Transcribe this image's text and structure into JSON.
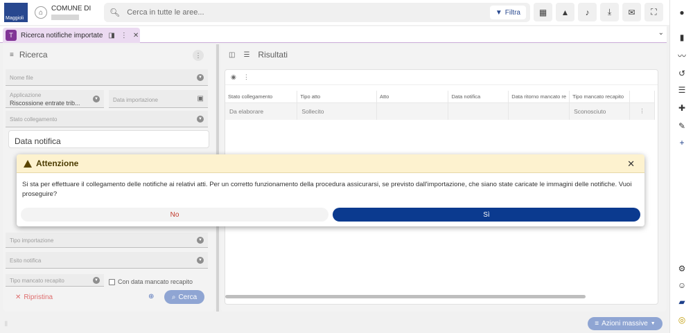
{
  "header": {
    "logo_text": "Maggioli",
    "comune_label": "COMUNE DI",
    "search_placeholder": "Cerca in tutte le aree...",
    "filter_label": "Filtra"
  },
  "tab": {
    "label": "Ricerca notifiche importate",
    "icon_text": "T"
  },
  "left_panel": {
    "title": "Ricerca",
    "fields": {
      "nome_file": "Nome file",
      "applicazione_label": "Applicazione",
      "applicazione_value": "Riscossione entrate trib...",
      "data_importazione": "Data importazione",
      "stato_collegamento": "Stato collegamento",
      "tipo_importazione": "Tipo importazione",
      "esito_notifica": "Esito notifica",
      "tipo_mancato_recapito": "Tipo mancato recapito"
    },
    "data_notifica_title": "Data notifica",
    "checkbox_label": "Con data mancato recapito",
    "reset_label": "Ripristina",
    "search_label": "Cerca"
  },
  "right_panel": {
    "title": "Risultati",
    "columns": [
      "Stato collegamento",
      "Tipo atto",
      "Atto",
      "Data notifica",
      "Data ritorno mancato re",
      "Tipo mancato recapito"
    ],
    "rows": [
      [
        "Da elaborare",
        "Sollecito",
        "",
        "",
        "",
        "Sconosciuto"
      ]
    ]
  },
  "footer": {
    "bulk_actions_label": "Azioni massive"
  },
  "dialog": {
    "title": "Attenzione",
    "message": "Si sta per effettuare il collegamento delle notifiche ai relativi atti. Per un corretto funzionamento della procedura assicurarsi, se previsto dall'importazione, che siano state caricate le immagini delle notifiche. Vuoi proseguire?",
    "no_label": "No",
    "yes_label": "Sì"
  },
  "colors": {
    "primary": "#0b3a8f",
    "tab_accent": "#7b2a91",
    "warning_bg": "#fdf2cf"
  }
}
